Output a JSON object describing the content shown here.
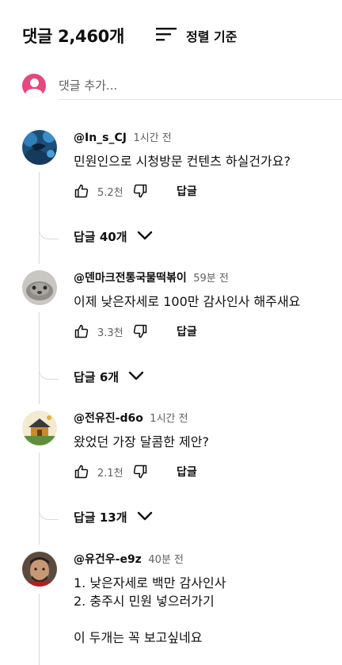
{
  "header": {
    "title": "댓글 2,460개",
    "sort_label": "정렬 기준"
  },
  "add_comment": {
    "placeholder": "댓글 추가..."
  },
  "comments": [
    {
      "author": "@In_s_CJ",
      "time": "1시간 전",
      "text": "민원인으로 시청방문 컨텐츠 하실건가요?",
      "likes": "5.2천",
      "reply_label": "답글",
      "replies_label": "답글 40개"
    },
    {
      "author": "@덴마크전통국물떡볶이",
      "time": "59분 전",
      "text": "이제 낮은자세로 100만 감사인사 해주새요",
      "likes": "3.3천",
      "reply_label": "답글",
      "replies_label": "답글 6개"
    },
    {
      "author": "@전유진-d6o",
      "time": "1시간 전",
      "text": "왔었던 가장 달콤한 제안?",
      "likes": "2.1천",
      "reply_label": "답글",
      "replies_label": "답글 13개"
    },
    {
      "author": "@유건우-e9z",
      "time": "40분 전",
      "text": "1. 낮은자세로 백만 감사인사\n2. 충주시 민원 넣으러가기\n\n이 두개는 꼭 보고싶네요"
    }
  ],
  "colors": {
    "text_primary": "#0f0f0f",
    "text_secondary": "#606060",
    "user_avatar": "#e8467c",
    "thread_line": "#d9d9d9"
  },
  "icons": {
    "sort": "sort-icon",
    "like": "thumbs-up-icon",
    "dislike": "thumbs-down-icon",
    "expand": "chevron-down-icon"
  }
}
